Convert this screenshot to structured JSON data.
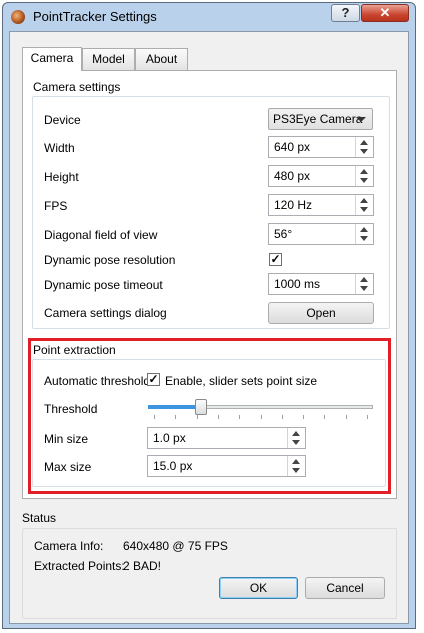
{
  "window": {
    "title": "PointTracker Settings",
    "help_glyph": "?",
    "close_glyph": "✕"
  },
  "tabs": [
    {
      "label": "Camera"
    },
    {
      "label": "Model"
    },
    {
      "label": "About"
    }
  ],
  "camera_settings": {
    "title": "Camera settings",
    "device": {
      "label": "Device",
      "value": "PS3Eye Camera"
    },
    "width": {
      "label": "Width",
      "value": "640 px"
    },
    "height": {
      "label": "Height",
      "value": "480 px"
    },
    "fps": {
      "label": "FPS",
      "value": "120 Hz"
    },
    "fov": {
      "label": "Diagonal field of view",
      "value": "56°"
    },
    "dynamic_pose_resolution": {
      "label": "Dynamic pose resolution",
      "checked": "✓"
    },
    "dynamic_pose_timeout": {
      "label": "Dynamic pose timeout",
      "value": "1000 ms"
    },
    "settings_dialog": {
      "label": "Camera settings dialog",
      "button": "Open"
    }
  },
  "point_extraction": {
    "title": "Point extraction",
    "auto_threshold": {
      "label": "Automatic threshold",
      "checked": "✓",
      "checkbox_label": "Enable, slider sets point size"
    },
    "threshold": {
      "label": "Threshold",
      "level": 0.22
    },
    "min_size": {
      "label": "Min size",
      "value": "1.0 px"
    },
    "max_size": {
      "label": "Max size",
      "value": "15.0 px"
    }
  },
  "status": {
    "title": "Status",
    "camera_info": {
      "label": "Camera Info:",
      "value": "640x480 @ 75 FPS"
    },
    "extracted_points": {
      "label": "Extracted Points:",
      "value": "2 BAD!"
    }
  },
  "buttons": {
    "ok": "OK",
    "cancel": "Cancel"
  },
  "colors": {
    "highlight": "#e21f26",
    "window_frame": "#b9d1ea",
    "slider_fill": "#3d95e0"
  }
}
